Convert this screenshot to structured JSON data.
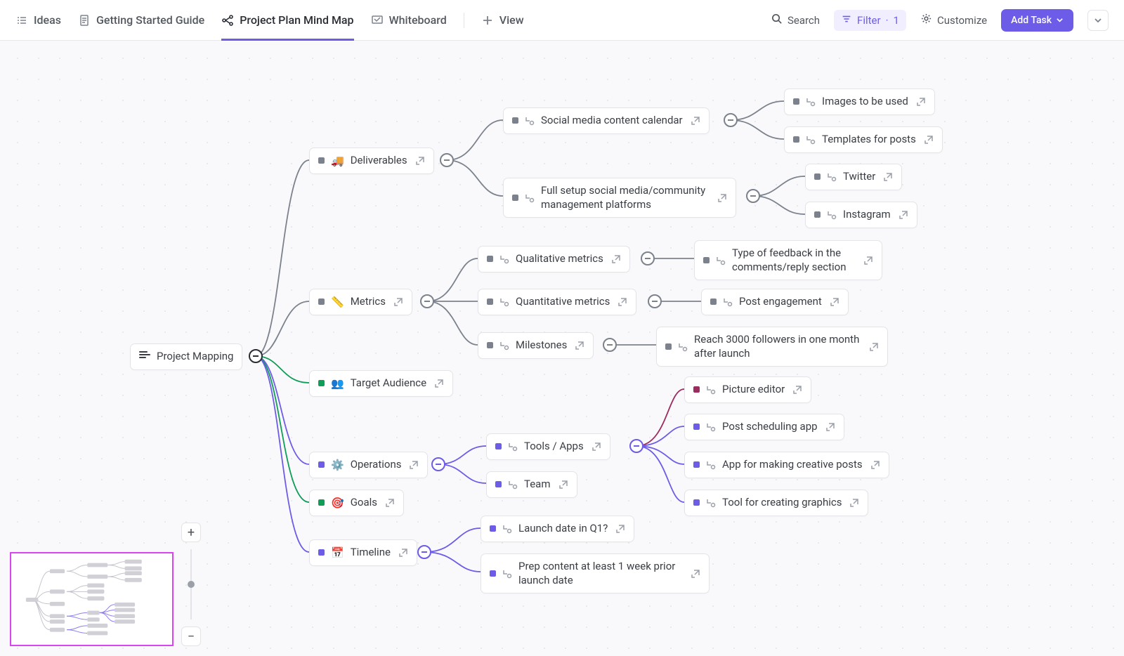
{
  "tabs": {
    "ideas": "Ideas",
    "guide": "Getting Started Guide",
    "mindmap": "Project Plan Mind Map",
    "whiteboard": "Whiteboard",
    "view": "View"
  },
  "toolbar": {
    "search": "Search",
    "filter": "Filter",
    "filter_count": "1",
    "customize": "Customize",
    "add_task": "Add Task"
  },
  "root": {
    "label": "Project Mapping"
  },
  "b1": {
    "label": "Deliverables",
    "emoji": "🚚",
    "c1": {
      "label": "Social media content calendar",
      "g1": "Images to be used",
      "g2": "Templates for posts"
    },
    "c2": {
      "label": "Full setup social media/community management platforms",
      "g1": "Twitter",
      "g2": "Instagram"
    }
  },
  "b2": {
    "label": "Metrics",
    "emoji": "📏",
    "c1": {
      "label": "Qualitative metrics",
      "g1": "Type of feedback in the comments/reply section"
    },
    "c2": {
      "label": "Quantitative metrics",
      "g1": "Post engagement"
    },
    "c3": {
      "label": "Milestones",
      "g1": "Reach 3000 followers in one month after launch"
    }
  },
  "b3": {
    "label": "Target Audience",
    "emoji": "👥"
  },
  "b4": {
    "label": "Operations",
    "emoji": "⚙️",
    "c1": {
      "label": "Tools / Apps",
      "g1": "Picture editor",
      "g2": "Post scheduling app",
      "g3": "App for making creative posts",
      "g4": "Tool for creating graphics"
    },
    "c2": {
      "label": "Team"
    }
  },
  "b5": {
    "label": "Goals",
    "emoji": "🎯"
  },
  "b6": {
    "label": "Timeline",
    "emoji": "📅",
    "c1": {
      "label": "Launch date in Q1?"
    },
    "c2": {
      "label": "Prep content at least 1 week prior launch date"
    }
  },
  "colors": {
    "grey": "#7c828d",
    "green": "#0f9d58",
    "purple": "#6c5ce7",
    "maroon": "#9b2c5e"
  }
}
